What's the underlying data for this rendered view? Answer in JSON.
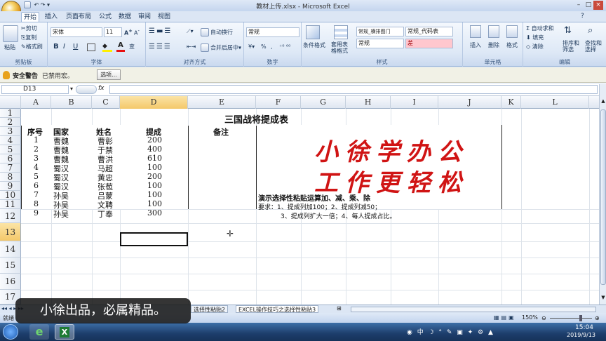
{
  "window": {
    "title": "教材上传.xlsx - Microsoft Excel"
  },
  "tabs": [
    "开始",
    "插入",
    "页面布局",
    "公式",
    "数据",
    "审阅",
    "视图"
  ],
  "ribbon": {
    "clipboard": {
      "label": "剪贴板",
      "paste": "粘贴",
      "cut": "剪切",
      "copy": "复制",
      "format_painter": "格式刷"
    },
    "font": {
      "label": "字体",
      "name": "宋体",
      "size": "11",
      "bold": "B",
      "italic": "I",
      "underline": "U"
    },
    "alignment": {
      "label": "对齐方式",
      "wrap": "自动换行",
      "merge": "合并后居中"
    },
    "number": {
      "label": "数字",
      "format": "常规",
      "percent": "%",
      "comma": ","
    },
    "styles": {
      "label": "样式",
      "cond_format": "条件格式",
      "table_format": "套用表格格式",
      "style1": "常规_横排图门",
      "style2": "常规_代码表",
      "style3": "常规",
      "style4": "差"
    },
    "cells": {
      "label": "单元格",
      "insert": "插入",
      "delete": "删除",
      "format": "格式"
    },
    "editing": {
      "label": "编辑",
      "autosum": "Σ 自动求和",
      "fill": "填充",
      "clear": "清除",
      "sort": "排序和筛选",
      "find": "查找和选择"
    }
  },
  "security": {
    "title": "安全警告",
    "message": "已禁用宏。",
    "button": "选项..."
  },
  "formula_bar": {
    "name_box": "D13",
    "fx": "fx",
    "value": ""
  },
  "columns": [
    "A",
    "B",
    "C",
    "D",
    "E",
    "F",
    "G",
    "H",
    "I",
    "J",
    "K",
    "L"
  ],
  "rows": [
    "1",
    "2",
    "3",
    "4",
    "5",
    "6",
    "7",
    "8",
    "9",
    "10",
    "11",
    "12",
    "13",
    "14",
    "15",
    "16",
    "17"
  ],
  "table": {
    "title": "三国战将提成表",
    "headers": [
      "序号",
      "国家",
      "姓名",
      "提成",
      "备注"
    ],
    "data": [
      [
        "1",
        "曹魏",
        "曹彰",
        "200"
      ],
      [
        "2",
        "曹魏",
        "于禁",
        "400"
      ],
      [
        "3",
        "曹魏",
        "曹洪",
        "610"
      ],
      [
        "4",
        "蜀汉",
        "马超",
        "100"
      ],
      [
        "5",
        "蜀汉",
        "黄忠",
        "200"
      ],
      [
        "6",
        "蜀汉",
        "张苞",
        "100"
      ],
      [
        "7",
        "孙吴",
        "吕蒙",
        "100"
      ],
      [
        "8",
        "孙吴",
        "文聘",
        "100"
      ],
      [
        "9",
        "孙吴",
        "丁奉",
        "300"
      ]
    ]
  },
  "calligraphy": {
    "line1": "小徐学办公",
    "line2": "工作更轻松"
  },
  "notes": {
    "line1": "演示选择性粘贴运算加、减、乘、除",
    "line2": "要求：1、提成列加100；2、提成列减50；",
    "line3": "3、提成列扩大一倍；4、每人提成占比。"
  },
  "sheet_tabs": {
    "tab1": "选择性粘贴2",
    "tab2": "EXCEL操作技巧之选择性粘贴3"
  },
  "status": {
    "left": "就绪",
    "zoom": "150%"
  },
  "subtitle": "小徐出品，必属精品。",
  "taskbar": {
    "time": "15:04",
    "date": "2019/9/13"
  }
}
